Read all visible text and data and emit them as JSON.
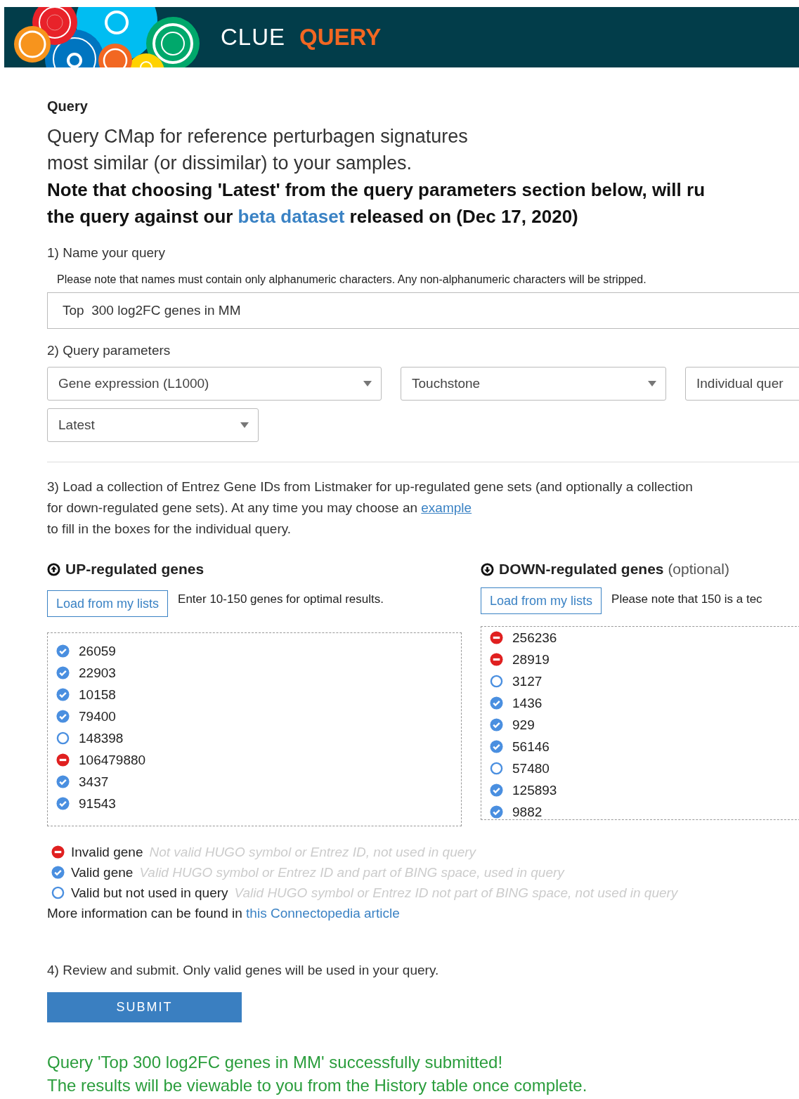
{
  "header": {
    "brand": "CLUE",
    "section": "QUERY"
  },
  "title": "Query",
  "intro": [
    "Query CMap for reference perturbagen signatures",
    "most similar (or dissimilar) to your samples."
  ],
  "note": {
    "before": "Note that choosing 'Latest' from the query parameters section below, will ru",
    "middle": "the query against our ",
    "link": "beta dataset",
    "after": " released on (Dec 17, 2020)"
  },
  "step1": {
    "label": "1) Name your query",
    "hint": "Please note that names must contain only alphanumeric characters. Any non-alphanumeric characters will be stripped.",
    "value": "Top  300 log2FC genes in MM"
  },
  "step2": {
    "label": "2) Query parameters",
    "selects": [
      {
        "value": "Gene expression (L1000)"
      },
      {
        "value": "Touchstone"
      },
      {
        "value": "Individual quer"
      },
      {
        "value": "Latest"
      }
    ]
  },
  "step3": {
    "before": "3) Load a collection of Entrez Gene IDs from Listmaker for up-regulated gene sets (and optionally a collection for down-regulated gene sets). At any time you may choose an ",
    "link": "example",
    "after": "to fill in the boxes for the individual query."
  },
  "panels": [
    {
      "kind": "up",
      "title": "UP-regulated genes",
      "button": "Load from my lists",
      "hint": "Enter 10-150 genes for optimal results.",
      "genes": [
        {
          "id": "26059",
          "kind": "valid"
        },
        {
          "id": "22903",
          "kind": "valid"
        },
        {
          "id": "10158",
          "kind": "valid"
        },
        {
          "id": "79400",
          "kind": "valid"
        },
        {
          "id": "148398",
          "kind": "unused"
        },
        {
          "id": "106479880",
          "kind": "invalid"
        },
        {
          "id": "3437",
          "kind": "valid"
        },
        {
          "id": "91543",
          "kind": "valid"
        }
      ]
    },
    {
      "kind": "down",
      "title": "DOWN-regulated genes",
      "optional": "(optional)",
      "button": "Load from my lists",
      "hint": "Please note that 150 is a tec",
      "genes": [
        {
          "id": "256236",
          "kind": "invalid"
        },
        {
          "id": "28919",
          "kind": "invalid"
        },
        {
          "id": "3127",
          "kind": "unused"
        },
        {
          "id": "1436",
          "kind": "valid"
        },
        {
          "id": "929",
          "kind": "valid"
        },
        {
          "id": "56146",
          "kind": "valid"
        },
        {
          "id": "57480",
          "kind": "unused"
        },
        {
          "id": "125893",
          "kind": "valid"
        },
        {
          "id": "9882",
          "kind": "valid"
        }
      ]
    }
  ],
  "legend": [
    {
      "kind": "invalid",
      "label": "Invalid gene",
      "description": "Not valid HUGO symbol or Entrez ID, not used in query"
    },
    {
      "kind": "valid",
      "label": "Valid gene",
      "description": "Valid HUGO symbol or Entrez ID and part of BING space, used in query"
    },
    {
      "kind": "unused",
      "label": "Valid but not used in query",
      "description": "Valid HUGO symbol or Entrez ID not part of BING space, not used in query"
    }
  ],
  "more_info": {
    "text": "More information can be found in ",
    "link": "this Connectopedia article"
  },
  "step4": {
    "label": "4) Review and submit. Only valid genes will be used in your query.",
    "button": "SUBMIT"
  },
  "success": [
    "Query 'Top 300 log2FC genes in MM' successfully submitted!",
    "The results will be viewable to you from the History table once complete."
  ]
}
